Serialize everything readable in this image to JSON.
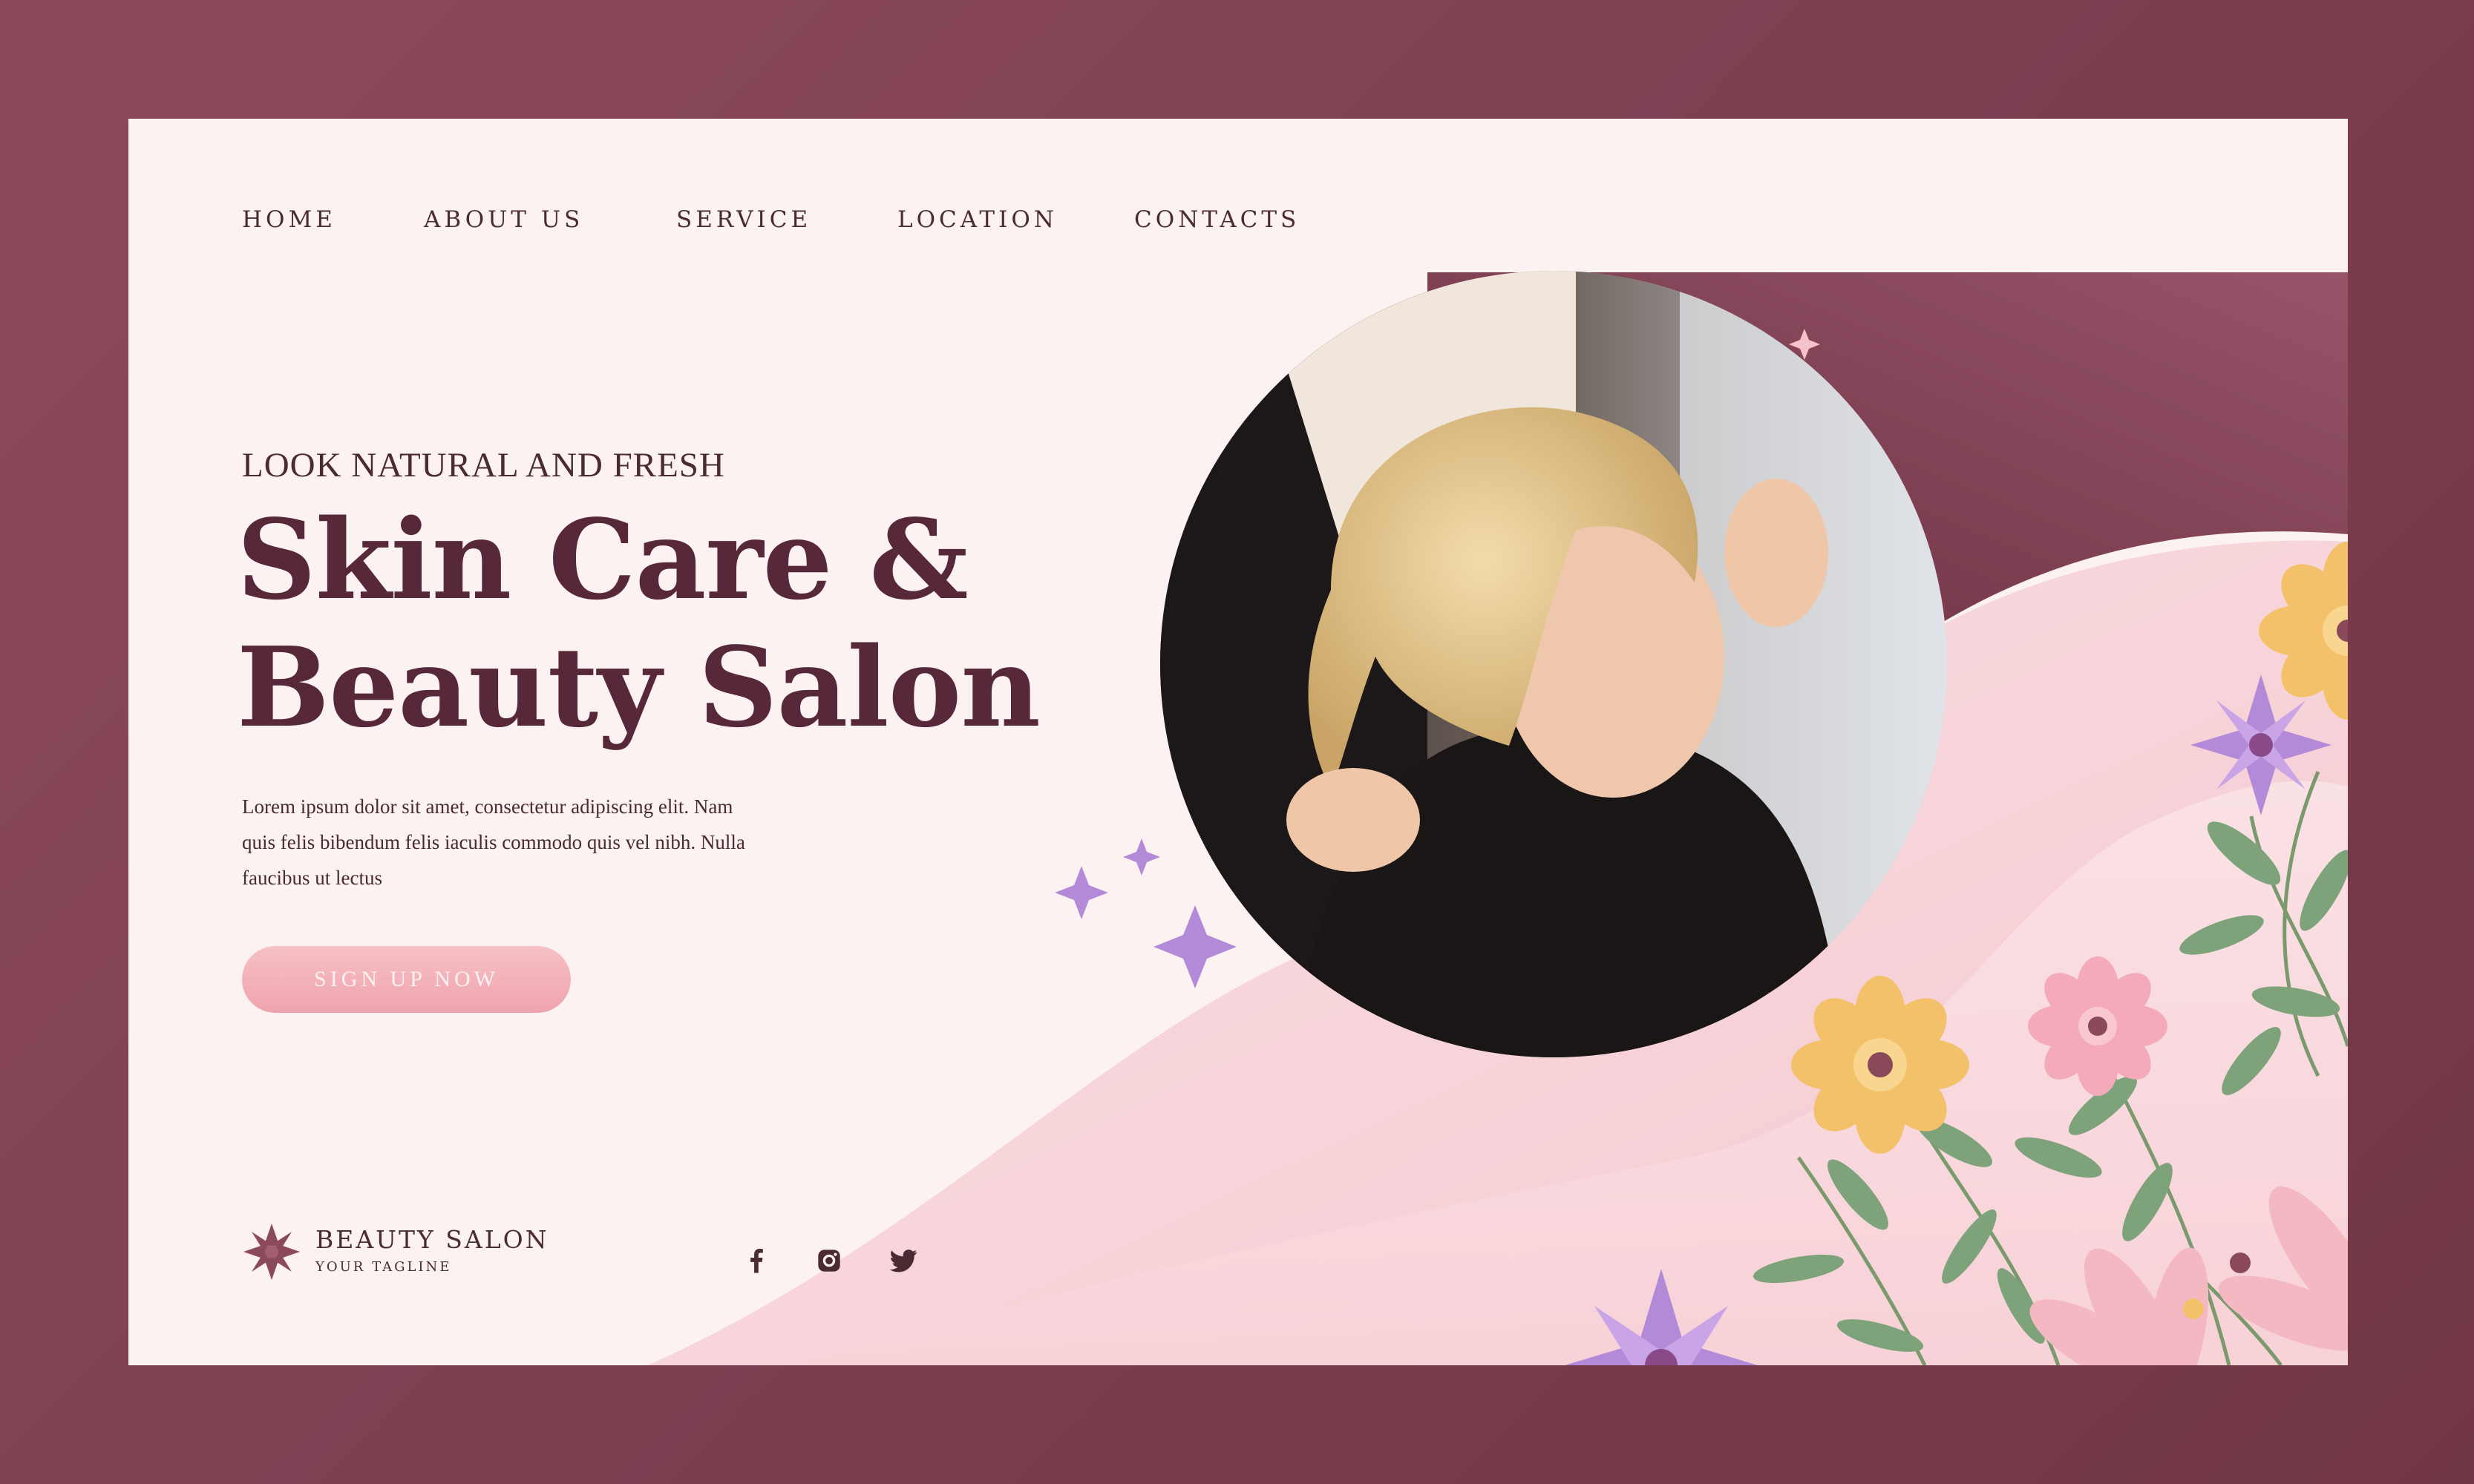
{
  "nav": {
    "items": [
      {
        "label": "HOME"
      },
      {
        "label": "ABOUT US"
      },
      {
        "label": "SERVICE"
      },
      {
        "label": "LOCATION"
      },
      {
        "label": "CONTACTS"
      }
    ]
  },
  "hero": {
    "tagline": "LOOK NATURAL AND FRESH",
    "headline_line1": "Skin Care &",
    "headline_line2": "Beauty Salon",
    "body_line1": "Lorem ipsum dolor sit amet, consectetur adipiscing elit. Nam",
    "body_line2": "quis felis bibendum felis iaculis commodo quis vel nibh. Nulla",
    "body_line3": "faucibus ut lectus",
    "cta_label": "SIGN UP NOW"
  },
  "footer": {
    "brand_name": "BEAUTY SALON",
    "brand_tagline": "YOUR TAGLINE",
    "social": [
      {
        "icon": "facebook-icon"
      },
      {
        "icon": "instagram-icon"
      },
      {
        "icon": "twitter-icon"
      }
    ]
  },
  "colors": {
    "outer_background": "#7a3d4e",
    "page_background": "#fdf2f2",
    "headline": "#57283a",
    "button": "#f4b3bc",
    "accent_purple": "#b38ad8",
    "accent_yellow": "#f4c16b"
  }
}
